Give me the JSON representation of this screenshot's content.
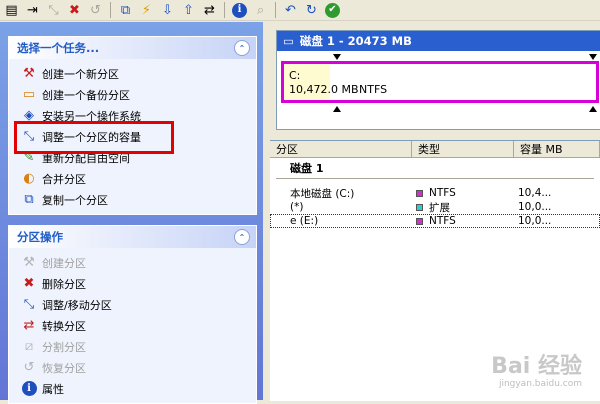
{
  "toolbar": {
    "buttons": [
      {
        "name": "create-partition-icon",
        "glyph": "▤"
      },
      {
        "name": "move-icon",
        "glyph": "⇥"
      },
      {
        "name": "resize-icon",
        "glyph": "⤡"
      },
      {
        "name": "delete-icon",
        "glyph": "✖"
      },
      {
        "name": "undo-gray-icon",
        "glyph": "↺"
      },
      {
        "name": "copy-icon",
        "glyph": "⧉"
      },
      {
        "name": "flash-icon",
        "glyph": "⚡"
      },
      {
        "name": "format-icon",
        "glyph": "⇩"
      },
      {
        "name": "label-icon",
        "glyph": "⇧"
      },
      {
        "name": "convert-icon",
        "glyph": "⇄"
      }
    ]
  },
  "tasks_panel": {
    "title": "选择一个任务...",
    "items": [
      {
        "label": "创建一个新分区",
        "icon": "new-partition-icon",
        "glyph": "⚒",
        "color": "ico-red"
      },
      {
        "label": "创建一个备份分区",
        "icon": "backup-partition-icon",
        "glyph": "▭",
        "color": "ico-orange"
      },
      {
        "label": "安装另一个操作系统",
        "icon": "install-os-icon",
        "glyph": "◈",
        "color": "ico-blue"
      },
      {
        "label": "调整一个分区的容量",
        "icon": "resize-partition-icon",
        "glyph": "⤡",
        "color": "ico-blue"
      },
      {
        "label": "重新分配自由空间",
        "icon": "redistribute-icon",
        "glyph": "✎",
        "color": "ico-green"
      },
      {
        "label": "合并分区",
        "icon": "merge-icon",
        "glyph": "◐",
        "color": "ico-orange"
      },
      {
        "label": "复制一个分区",
        "icon": "copy-partition-icon",
        "glyph": "⧉",
        "color": "ico-blue"
      }
    ]
  },
  "partition_ops_panel": {
    "title": "分区操作",
    "items": [
      {
        "label": "创建分区",
        "icon": "create-icon",
        "glyph": "⚒",
        "color": "",
        "disabled": true
      },
      {
        "label": "删除分区",
        "icon": "delete-partition-icon",
        "glyph": "✖",
        "color": "ico-red",
        "disabled": false
      },
      {
        "label": "调整/移动分区",
        "icon": "resize-move-icon",
        "glyph": "⤡",
        "color": "ico-blue",
        "disabled": false
      },
      {
        "label": "转换分区",
        "icon": "convert-partition-icon",
        "glyph": "⇄",
        "color": "ico-red",
        "disabled": false
      },
      {
        "label": "分割分区",
        "icon": "split-icon",
        "glyph": "⧄",
        "color": "",
        "disabled": true
      },
      {
        "label": "恢复分区",
        "icon": "restore-icon",
        "glyph": "↺",
        "color": "",
        "disabled": true
      },
      {
        "label": "属性",
        "icon": "info-icon",
        "glyph": "i",
        "color": "ico-blue",
        "disabled": false
      }
    ]
  },
  "disk_view": {
    "title": "磁盘 1 - 20473 MB",
    "partition_drive": "C:",
    "partition_size": "10,472.0 MB",
    "partition_fs": "NTFS"
  },
  "list": {
    "columns": [
      "分区",
      "类型",
      "容量 MB"
    ],
    "group": "磁盘 1",
    "rows": [
      {
        "name": "本地磁盘 (C:)",
        "type": "NTFS",
        "color": "#cc33cc",
        "size": "10,4...",
        "dotted": false
      },
      {
        "name": "(*)",
        "type": "扩展",
        "color": "#33cccc",
        "size": "10,0...",
        "dotted": false
      },
      {
        "name": "e (E:)",
        "type": "NTFS",
        "color": "#cc33cc",
        "size": "10,0...",
        "dotted": true
      }
    ]
  },
  "watermark": {
    "main": "Bai 经验",
    "sub": "jingyan.baidu.com"
  }
}
